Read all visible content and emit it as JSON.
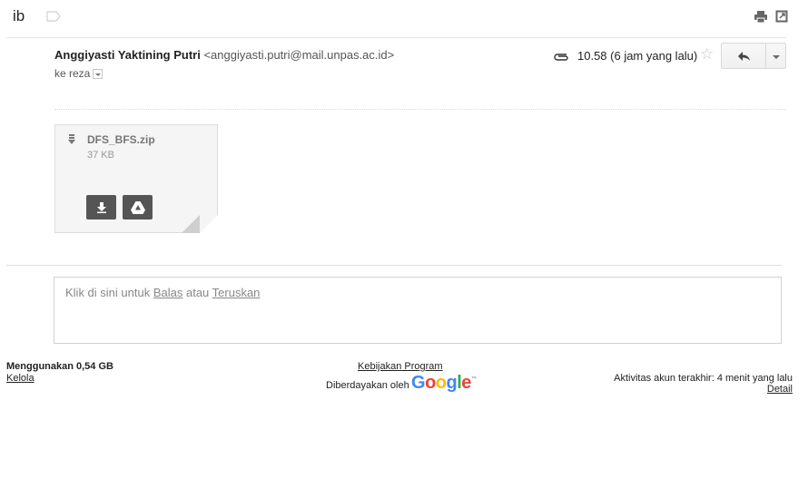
{
  "header": {
    "subject": "ib"
  },
  "message": {
    "sender_name": "Anggiyasti Yaktining Putri",
    "sender_email": "<anggiyasti.putri@mail.unpas.ac.id>",
    "recipient": "ke reza",
    "timestamp": "10.58 (6 jam yang lalu)"
  },
  "attachment": {
    "file_name": "DFS_BFS.zip",
    "file_size": "37 KB"
  },
  "reply_box": {
    "prefix": "Klik di sini untuk ",
    "reply_link": "Balas",
    "middle": " atau ",
    "forward_link": "Teruskan"
  },
  "footer": {
    "storage_used": "Menggunakan 0,54 GB",
    "manage": "Kelola",
    "program_policy": "Kebijakan Program",
    "powered_by": "Diberdayakan oleh",
    "google_letters": [
      "G",
      "o",
      "o",
      "g",
      "l",
      "e"
    ],
    "google_tm": "™",
    "last_activity": "Aktivitas akun terakhir: 4 menit yang lalu",
    "details": "Detail"
  },
  "colors": {
    "google_blue": "#4285F4",
    "google_red": "#EA4335",
    "google_yellow": "#FBBC05",
    "google_green": "#34A853",
    "action_button_bg": "#555555"
  },
  "icons": {
    "label": "label-icon",
    "print": "print-icon",
    "popout": "open-in-new-window-icon",
    "attachment": "paperclip-icon",
    "star": "star-icon",
    "reply": "reply-icon",
    "more": "chevron-down-icon",
    "file": "zip-file-icon",
    "download": "download-icon",
    "drive": "google-drive-icon"
  }
}
